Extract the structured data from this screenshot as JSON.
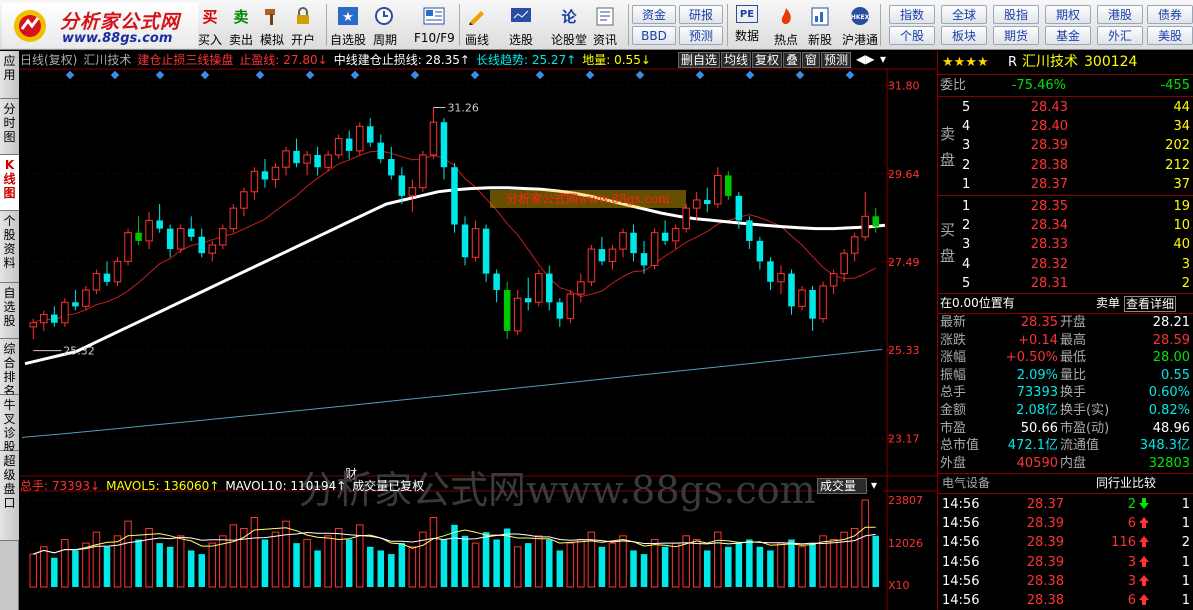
{
  "toolbar": {
    "logo_title": "分析家公式网",
    "logo_url": "www.88gs.com",
    "tools": [
      {
        "label": "买入",
        "icon": "买",
        "color": "#d00000"
      },
      {
        "label": "卖出",
        "icon": "卖",
        "color": "#008800"
      },
      {
        "label": "模拟",
        "icon": "hammer-icon"
      },
      {
        "label": "开户",
        "icon": "lock-icon"
      },
      {
        "label": "自选股",
        "icon": "star-icon"
      },
      {
        "label": "周期",
        "icon": "clock-icon"
      },
      {
        "label": "F10/F9",
        "icon": "f10-icon"
      },
      {
        "label": "画线",
        "icon": "pencil-icon"
      },
      {
        "label": "选股",
        "icon": "screen-icon"
      },
      {
        "label": "论股堂",
        "icon": "论"
      },
      {
        "label": "资讯",
        "icon": "news-icon"
      },
      {
        "label": "数据",
        "icon": "PE"
      },
      {
        "label": "热点",
        "icon": "fire-icon"
      },
      {
        "label": "新股",
        "icon": "newstock-icon"
      },
      {
        "label": "沪港通",
        "icon": "hkex-icon"
      }
    ],
    "center_buttons": [
      [
        "资金",
        "研报"
      ],
      [
        "BBD",
        "预测"
      ]
    ],
    "right_buttons": [
      [
        "指数",
        "全球",
        "股指",
        "期权",
        "港股",
        "债券"
      ],
      [
        "个股",
        "板块",
        "期货",
        "基金",
        "外汇",
        "美股"
      ]
    ]
  },
  "left_tabs": [
    "应用",
    "分时图",
    "K线图",
    "个股资料",
    "自选股",
    "综合排名",
    "牛叉诊股",
    "超级盘口"
  ],
  "chart": {
    "info_segments": [
      {
        "text": "日线(复权)",
        "color": "#aaaaaa"
      },
      {
        "text": "汇川技术",
        "color": "#aaaaaa"
      },
      {
        "text": "建仓止损三线操盘",
        "color": "#ff3232"
      },
      {
        "text": "止盈线: 27.80↓",
        "color": "#ff3232"
      },
      {
        "text": "中线建仓止损线: 28.35↑",
        "color": "#ffffff"
      },
      {
        "text": "长线趋势: 25.27↑",
        "color": "#00e8e8"
      },
      {
        "text": "地量: 0.55↓",
        "color": "#ffff00"
      }
    ],
    "chart_tabs": [
      "删自选",
      "均线",
      "复权",
      "叠",
      "窗",
      "预测"
    ],
    "price_axis": [
      "31.80",
      "29.64",
      "27.49",
      "25.33",
      "23.17"
    ],
    "max_label": "31.26",
    "min_label": "25.32",
    "event_marker": "财",
    "watermark": "分析家公式网www.88gs.com",
    "watermark2": "分析家公式网www.88gs.com",
    "vol_info_segments": [
      {
        "text": "总手: 73393↓",
        "color": "#ff3232"
      },
      {
        "text": "MAVOL5: 136060↑",
        "color": "#ffff00"
      },
      {
        "text": "MAVOL10: 110194↑",
        "color": "#ffffff"
      },
      {
        "text": "成交量已复权",
        "color": "#ffffff"
      }
    ],
    "vol_dropdown": "成交量",
    "vol_axis": [
      "23807",
      "12026"
    ],
    "vol_unit": "X10",
    "colors": {
      "up": "#ff3232",
      "down": "#00e8e8",
      "down_green": "#00c800",
      "ma_white": "#ffffff",
      "ma_red": "#c81e1e",
      "ma_cyan": "#50a0b4"
    }
  },
  "chart_data": {
    "type": "candlestick",
    "y_range": [
      22.5,
      32.2
    ],
    "candles": [
      [
        25.9,
        26.1,
        25.6,
        26.0
      ],
      [
        26.0,
        26.3,
        25.8,
        26.2
      ],
      [
        26.2,
        26.4,
        25.9,
        26.0
      ],
      [
        26.0,
        26.6,
        25.9,
        26.5
      ],
      [
        26.5,
        26.8,
        26.3,
        26.4
      ],
      [
        26.4,
        26.9,
        26.3,
        26.8
      ],
      [
        26.8,
        27.3,
        26.7,
        27.2
      ],
      [
        27.2,
        27.5,
        26.9,
        27.0
      ],
      [
        27.0,
        27.6,
        26.9,
        27.5
      ],
      [
        27.5,
        28.3,
        27.4,
        28.2
      ],
      [
        28.2,
        28.6,
        27.9,
        28.0
      ],
      [
        28.0,
        28.7,
        27.8,
        28.5
      ],
      [
        28.5,
        28.9,
        28.2,
        28.3
      ],
      [
        28.3,
        28.4,
        27.6,
        27.8
      ],
      [
        27.8,
        28.4,
        27.7,
        28.3
      ],
      [
        28.3,
        28.6,
        28.0,
        28.1
      ],
      [
        28.1,
        28.3,
        27.6,
        27.7
      ],
      [
        27.7,
        28.0,
        27.5,
        27.9
      ],
      [
        27.9,
        28.4,
        27.8,
        28.3
      ],
      [
        28.3,
        28.9,
        28.2,
        28.8
      ],
      [
        28.8,
        29.3,
        28.6,
        29.2
      ],
      [
        29.2,
        29.8,
        29.0,
        29.7
      ],
      [
        29.7,
        30.0,
        29.3,
        29.5
      ],
      [
        29.5,
        29.9,
        29.3,
        29.8
      ],
      [
        29.8,
        30.3,
        29.6,
        30.2
      ],
      [
        30.2,
        30.5,
        29.8,
        29.9
      ],
      [
        29.9,
        30.2,
        29.6,
        30.1
      ],
      [
        30.1,
        30.3,
        29.6,
        29.8
      ],
      [
        29.8,
        30.2,
        29.7,
        30.1
      ],
      [
        30.1,
        30.6,
        30.0,
        30.5
      ],
      [
        30.5,
        30.7,
        30.0,
        30.2
      ],
      [
        30.2,
        30.9,
        30.1,
        30.8
      ],
      [
        30.8,
        31.0,
        30.3,
        30.4
      ],
      [
        30.4,
        30.6,
        29.9,
        30.0
      ],
      [
        30.0,
        30.3,
        29.5,
        29.6
      ],
      [
        29.6,
        29.8,
        28.9,
        29.1
      ],
      [
        29.1,
        29.5,
        28.7,
        29.3
      ],
      [
        29.3,
        30.2,
        29.2,
        30.1
      ],
      [
        30.1,
        31.26,
        30.0,
        30.9
      ],
      [
        30.9,
        31.0,
        29.5,
        29.8
      ],
      [
        29.8,
        29.9,
        28.2,
        28.4
      ],
      [
        28.4,
        28.6,
        27.4,
        27.6
      ],
      [
        27.6,
        28.5,
        27.5,
        28.3
      ],
      [
        28.3,
        28.4,
        27.0,
        27.2
      ],
      [
        27.2,
        27.3,
        26.5,
        26.8
      ],
      [
        26.8,
        27.0,
        25.6,
        25.8
      ],
      [
        25.8,
        26.8,
        25.7,
        26.6
      ],
      [
        26.6,
        27.1,
        26.3,
        26.5
      ],
      [
        26.5,
        27.3,
        26.4,
        27.2
      ],
      [
        27.2,
        27.4,
        26.3,
        26.5
      ],
      [
        26.5,
        26.6,
        25.9,
        26.1
      ],
      [
        26.1,
        26.8,
        26.0,
        26.7
      ],
      [
        26.7,
        27.2,
        26.5,
        27.0
      ],
      [
        27.0,
        27.9,
        26.9,
        27.8
      ],
      [
        27.8,
        28.1,
        27.4,
        27.5
      ],
      [
        27.5,
        27.9,
        27.3,
        27.8
      ],
      [
        27.8,
        28.3,
        27.6,
        28.2
      ],
      [
        28.2,
        28.4,
        27.5,
        27.7
      ],
      [
        27.7,
        28.0,
        27.2,
        27.4
      ],
      [
        27.4,
        28.3,
        27.3,
        28.2
      ],
      [
        28.2,
        28.5,
        27.9,
        28.0
      ],
      [
        28.0,
        28.4,
        27.8,
        28.3
      ],
      [
        28.3,
        28.9,
        28.2,
        28.8
      ],
      [
        28.8,
        29.2,
        28.5,
        29.0
      ],
      [
        29.0,
        29.3,
        28.7,
        28.9
      ],
      [
        28.9,
        29.8,
        28.8,
        29.6
      ],
      [
        29.6,
        29.7,
        29.0,
        29.1
      ],
      [
        29.1,
        29.2,
        28.3,
        28.5
      ],
      [
        28.5,
        28.6,
        27.8,
        28.0
      ],
      [
        28.0,
        28.1,
        27.3,
        27.5
      ],
      [
        27.5,
        27.6,
        26.8,
        27.0
      ],
      [
        27.0,
        27.4,
        26.7,
        27.2
      ],
      [
        27.2,
        27.3,
        26.2,
        26.4
      ],
      [
        26.4,
        26.9,
        26.3,
        26.8
      ],
      [
        26.8,
        26.9,
        25.8,
        26.1
      ],
      [
        26.1,
        27.0,
        26.0,
        26.9
      ],
      [
        26.9,
        27.3,
        26.7,
        27.2
      ],
      [
        27.2,
        27.8,
        27.0,
        27.7
      ],
      [
        27.7,
        28.2,
        27.5,
        28.1
      ],
      [
        28.1,
        29.2,
        28.0,
        28.6
      ],
      [
        28.6,
        28.8,
        28.2,
        28.35
      ]
    ],
    "volumes": [
      9,
      11,
      8,
      13,
      10,
      12,
      15,
      11,
      14,
      18,
      13,
      16,
      12,
      11,
      14,
      10,
      9,
      12,
      14,
      17,
      16,
      19,
      13,
      15,
      18,
      12,
      13,
      10,
      14,
      16,
      13,
      17,
      11,
      10,
      9,
      12,
      11,
      15,
      19,
      13,
      17,
      14,
      12,
      15,
      13,
      16,
      11,
      12,
      14,
      13,
      10,
      12,
      13,
      15,
      11,
      12,
      14,
      10,
      9,
      13,
      11,
      12,
      14,
      13,
      10,
      15,
      11,
      12,
      13,
      11,
      10,
      12,
      13,
      11,
      12,
      14,
      13,
      15,
      16,
      23.8,
      14
    ],
    "ma_white": [
      25.0,
      25.1,
      25.2,
      25.3,
      25.5,
      25.7,
      25.9,
      26.1,
      26.3,
      26.5,
      26.7,
      26.9,
      27.1,
      27.3,
      27.5,
      27.7,
      27.9,
      28.1,
      28.3,
      28.5,
      28.7,
      28.9,
      29.0,
      29.1,
      29.2,
      29.25,
      29.28,
      29.3,
      29.3,
      29.28,
      29.26,
      29.22,
      29.16,
      29.08,
      28.98,
      28.88,
      28.78,
      28.68,
      28.6,
      28.54,
      28.5,
      28.46,
      28.42,
      28.38,
      28.35,
      28.32,
      28.3,
      28.3,
      28.32,
      28.34,
      28.38
    ],
    "ma_cyan_start": 23.2,
    "ma_cyan_end": 25.35
  },
  "right_panel": {
    "stars": "★★★★",
    "rflag": "R",
    "stock_name": "汇川技术",
    "stock_code": "300124",
    "weibi_label": "委比",
    "weibi_value": "-75.46%",
    "weicha_value": "-455",
    "sell_side_label": "卖盘",
    "buy_side_label": "买盘",
    "sells": [
      {
        "n": "5",
        "p": "28.43",
        "v": "44"
      },
      {
        "n": "4",
        "p": "28.40",
        "v": "34"
      },
      {
        "n": "3",
        "p": "28.39",
        "v": "202"
      },
      {
        "n": "2",
        "p": "28.38",
        "v": "212"
      },
      {
        "n": "1",
        "p": "28.37",
        "v": "37"
      }
    ],
    "buys": [
      {
        "n": "1",
        "p": "28.35",
        "v": "19"
      },
      {
        "n": "2",
        "p": "28.34",
        "v": "10"
      },
      {
        "n": "3",
        "p": "28.33",
        "v": "40"
      },
      {
        "n": "4",
        "p": "28.32",
        "v": "3"
      },
      {
        "n": "5",
        "p": "28.31",
        "v": "2"
      }
    ],
    "position_text": "在0.00位置有",
    "sell_order_label": "卖单",
    "detail_link": "查看详细",
    "quotes": [
      {
        "l": "最新",
        "v": "28.35",
        "lc": "red",
        "r": "开盘",
        "rv": "28.21",
        "rc": "wh"
      },
      {
        "l": "涨跌",
        "v": "+0.14",
        "lc": "red",
        "r": "最高",
        "rv": "28.59",
        "rc": "red"
      },
      {
        "l": "涨幅",
        "v": "+0.50%",
        "lc": "red",
        "r": "最低",
        "rv": "28.00",
        "rc": "grn"
      },
      {
        "l": "振幅",
        "v": "2.09%",
        "lc": "cy",
        "r": "量比",
        "rv": "0.55",
        "rc": "cy"
      },
      {
        "l": "总手",
        "v": "73393",
        "lc": "cy",
        "r": "换手",
        "rv": "0.60%",
        "rc": "cy"
      },
      {
        "l": "金额",
        "v": "2.08亿",
        "lc": "cy",
        "r": "换手(实)",
        "rv": "0.82%",
        "rc": "cy"
      },
      {
        "l": "市盈",
        "v": "50.66",
        "lc": "wh",
        "r": "市盈(动)",
        "rv": "48.96",
        "rc": "wh"
      },
      {
        "l": "总市值",
        "v": "472.1亿",
        "lc": "cy",
        "r": "流通值",
        "rv": "348.3亿",
        "rc": "cy"
      },
      {
        "l": "外盘",
        "v": "40590",
        "lc": "red",
        "r": "内盘",
        "rv": "32803",
        "rc": "grn"
      }
    ],
    "industry_label": "电气设备",
    "peer_compare": "同行业比较",
    "ticks": [
      {
        "t": "14:56",
        "p": "28.37",
        "v": "2",
        "dir": "down",
        "n": "1"
      },
      {
        "t": "14:56",
        "p": "28.39",
        "v": "6",
        "dir": "up",
        "n": "1"
      },
      {
        "t": "14:56",
        "p": "28.39",
        "v": "116",
        "dir": "up",
        "n": "2"
      },
      {
        "t": "14:56",
        "p": "28.39",
        "v": "3",
        "dir": "up",
        "n": "1"
      },
      {
        "t": "14:56",
        "p": "28.38",
        "v": "3",
        "dir": "up",
        "n": "1"
      },
      {
        "t": "14:56",
        "p": "28.38",
        "v": "6",
        "dir": "up",
        "n": "1"
      }
    ]
  }
}
